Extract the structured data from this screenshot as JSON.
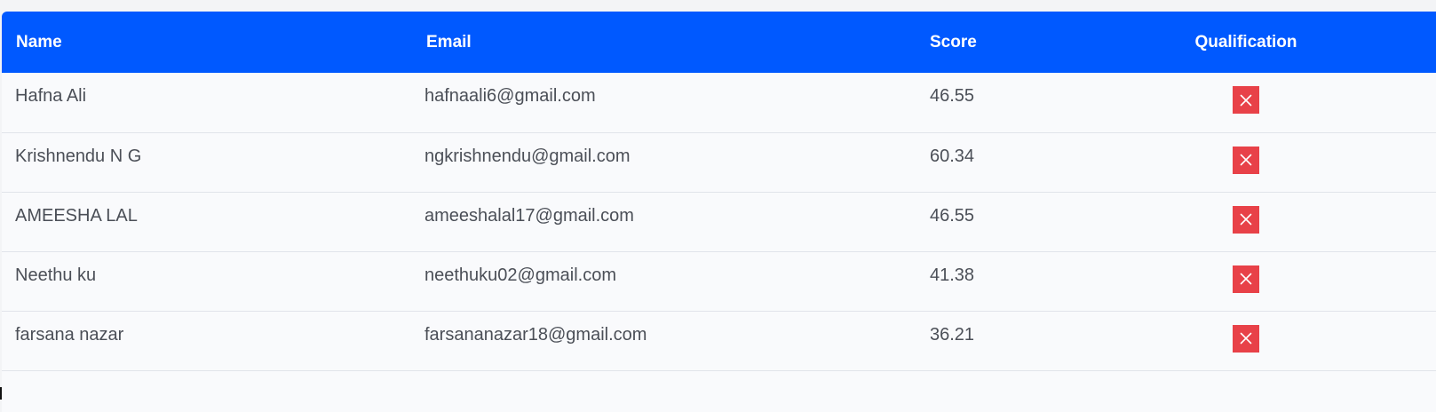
{
  "table": {
    "headers": {
      "name": "Name",
      "email": "Email",
      "score": "Score",
      "qualification": "Qualification"
    },
    "rows": [
      {
        "name": "Hafna Ali",
        "email": "hafnaali6@gmail.com",
        "score": "46.55",
        "qualified": false,
        "qualification_icon": "close-icon"
      },
      {
        "name": "Krishnendu N G",
        "email": "ngkrishnendu@gmail.com",
        "score": "60.34",
        "qualified": false,
        "qualification_icon": "close-icon"
      },
      {
        "name": "AMEESHA LAL",
        "email": "ameeshalal17@gmail.com",
        "score": "46.55",
        "qualified": false,
        "qualification_icon": "close-icon"
      },
      {
        "name": "Neethu ku",
        "email": "neethuku02@gmail.com",
        "score": "41.38",
        "qualified": false,
        "qualification_icon": "close-icon"
      },
      {
        "name": "farsana nazar",
        "email": "farsananazar18@gmail.com",
        "score": "36.21",
        "qualified": false,
        "qualification_icon": "close-icon"
      }
    ]
  },
  "colors": {
    "header_background": "#0059ff",
    "not_qualified": "#e84148",
    "text": "#4b4f57",
    "row_divider": "#e1e4ea"
  }
}
